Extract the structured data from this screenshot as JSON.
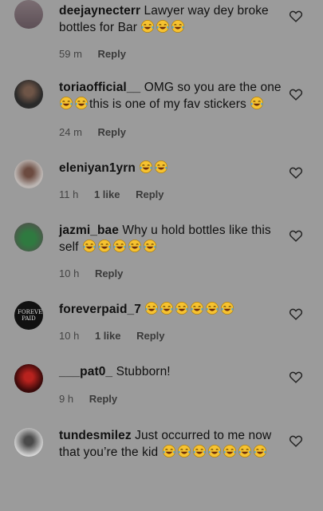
{
  "comments": [
    {
      "user": "deejaynecterr",
      "text": "Lawyer way dey broke bottles for Bar",
      "emoji": 3,
      "time": "59 m",
      "likes": "",
      "reply": "Reply"
    },
    {
      "user": "toriaofficial__",
      "text": "OMG so you are the one",
      "mid_emoji": 2,
      "text2": "this is one of my fav stickers",
      "emoji": 1,
      "time": "24 m",
      "likes": "",
      "reply": "Reply"
    },
    {
      "user": "eleniyan1yrn",
      "text": "",
      "emoji": 2,
      "time": "11 h",
      "likes": "1 like",
      "reply": "Reply"
    },
    {
      "user": "jazmi_bae",
      "text": "Why u hold bottles like this self",
      "emoji": 5,
      "time": "10 h",
      "likes": "",
      "reply": "Reply"
    },
    {
      "user": "foreverpaid_7",
      "text": "",
      "emoji": 6,
      "time": "10 h",
      "likes": "1 like",
      "reply": "Reply"
    },
    {
      "user": "___pat0_",
      "text": "Stubborn!",
      "emoji": 0,
      "time": "9 h",
      "likes": "",
      "reply": "Reply"
    },
    {
      "user": "tundesmilez",
      "text": "Just occurred to me now that you’re the kid",
      "emoji": 7,
      "time": "",
      "likes": "",
      "reply": ""
    }
  ],
  "avatar_labels": {
    "foreverpaid_7": "FOREVER PAID"
  },
  "icons": {
    "like": "heart-outline-icon",
    "emoji": "face-with-tears-of-joy-icon"
  },
  "colors": {
    "background": "#9b9b9b",
    "meta": "#444444"
  }
}
